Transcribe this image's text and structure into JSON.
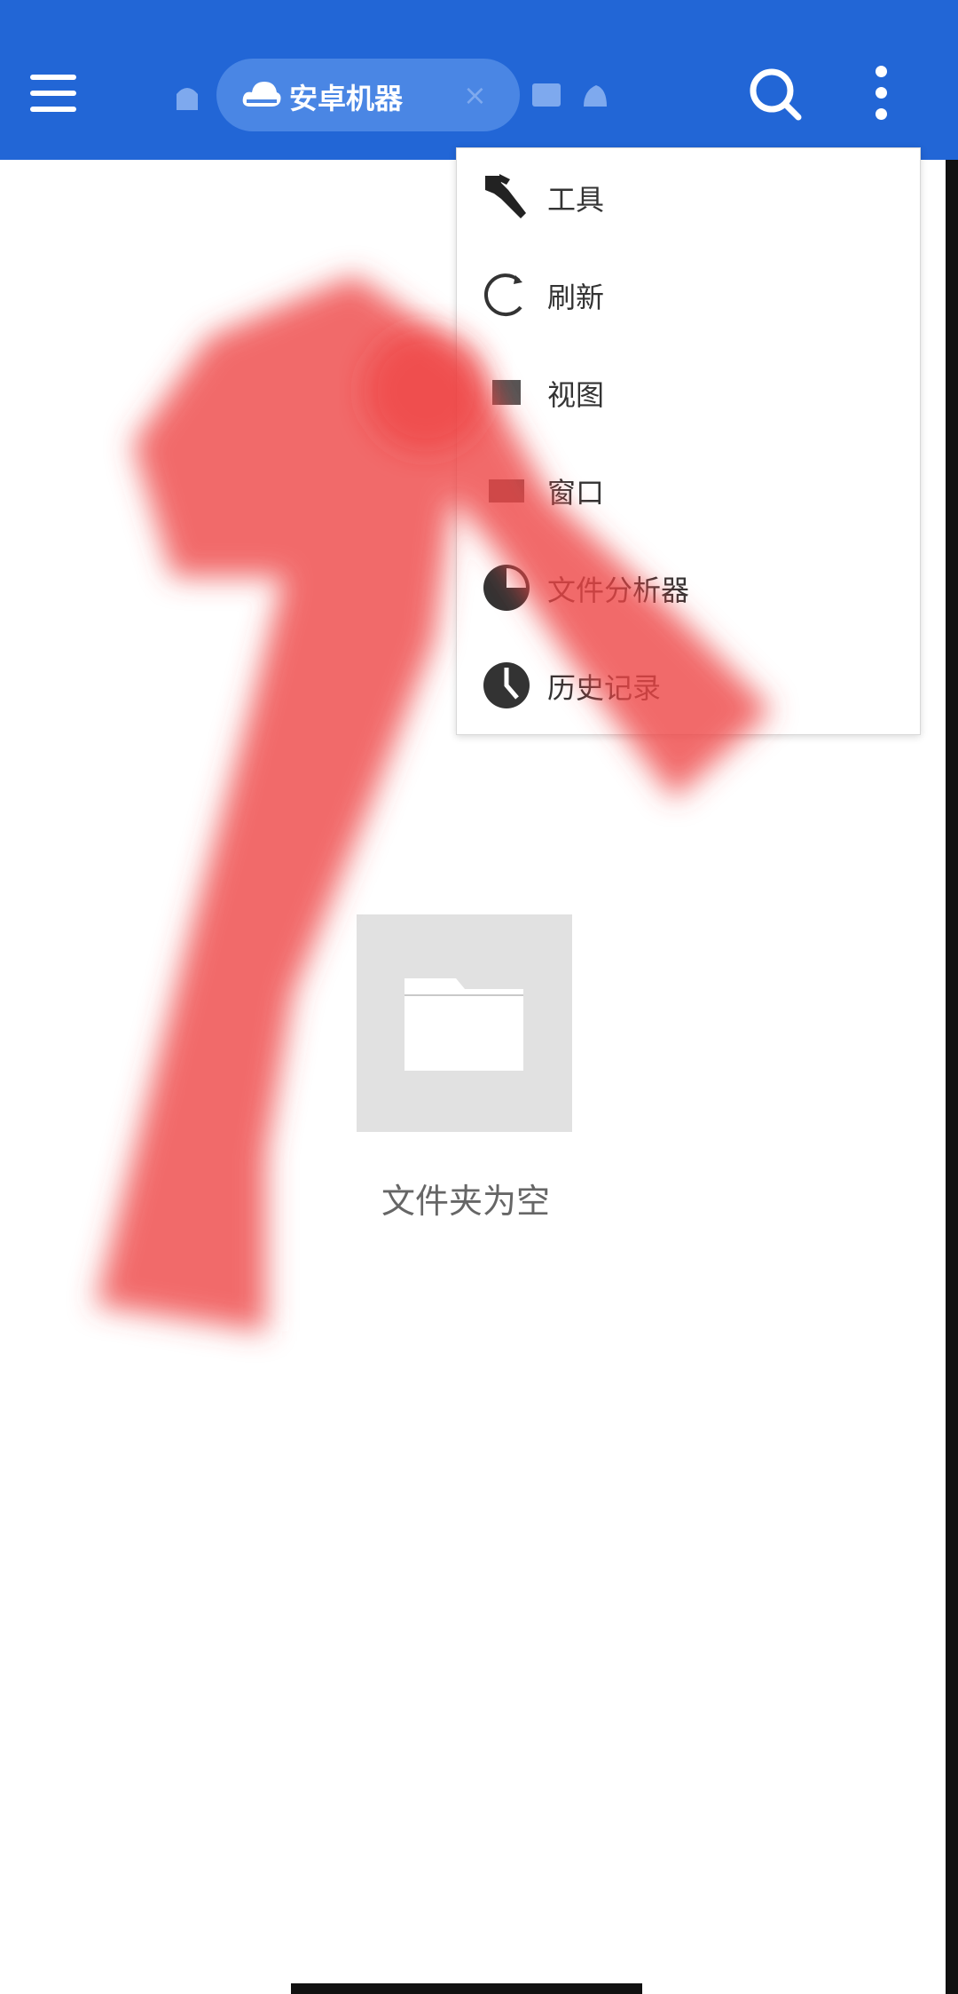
{
  "appbar": {
    "menu_icon": "hamburger-menu-icon",
    "home_icon": "home-icon",
    "tab": {
      "icon": "cloud-icon",
      "label": "安卓机器",
      "close_label": "×"
    },
    "search_icon": "search-icon",
    "more_icon": "more-vertical-icon",
    "color": "#2266d6"
  },
  "popup_menu": {
    "items": [
      {
        "label": "工具",
        "icon": "wrench-icon"
      },
      {
        "label": "刷新",
        "icon": "refresh-icon"
      },
      {
        "label": "视图",
        "icon": "view-icon"
      },
      {
        "label": "窗口",
        "icon": "window-icon"
      },
      {
        "label": "文件分析器",
        "icon": "pie-chart-icon"
      },
      {
        "label": "历史记录",
        "icon": "history-clock-icon"
      }
    ]
  },
  "empty_state": {
    "icon": "folder-icon",
    "text": "文件夹为空"
  },
  "annotation": {
    "icon": "arrow-annotation-icon",
    "color": "#ee4444"
  }
}
